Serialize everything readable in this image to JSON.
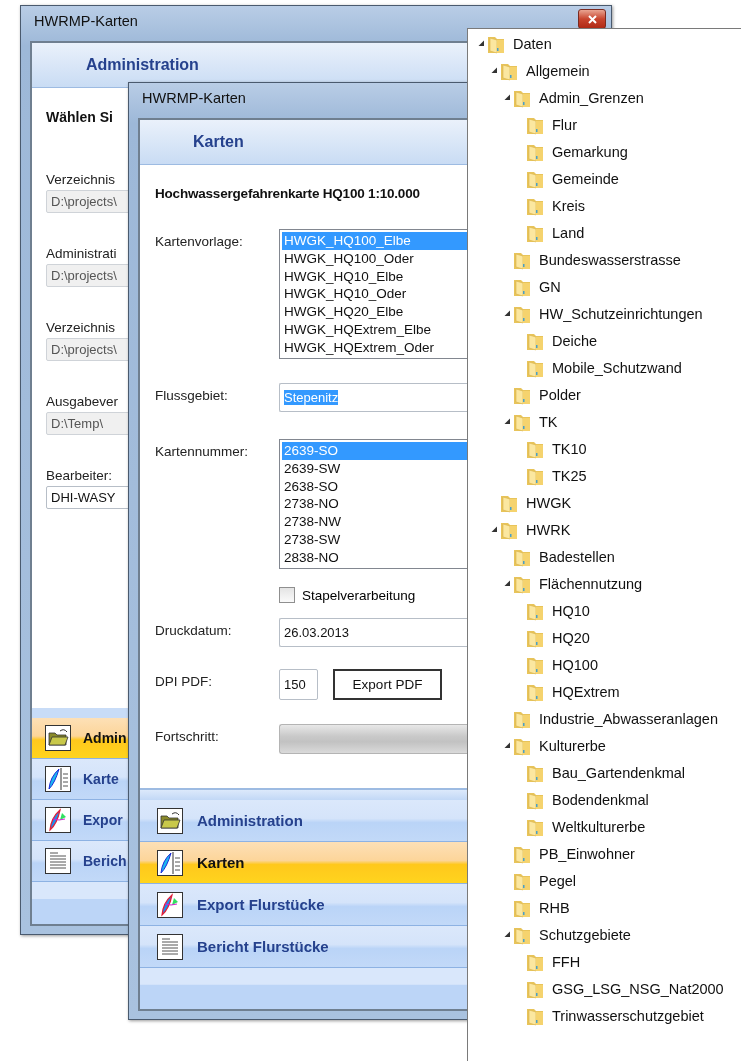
{
  "back_window": {
    "title": "HWRMP-Karten",
    "header": "Administration",
    "heading": "Wählen Si",
    "fields": [
      {
        "label": "Verzeichnis",
        "value": "D:\\projects\\",
        "disabled": true
      },
      {
        "label": "Administrati",
        "value": "D:\\projects\\",
        "disabled": true
      },
      {
        "label": "Verzeichnis",
        "value": "D:\\projects\\",
        "disabled": true
      },
      {
        "label": "Ausgabever",
        "value": "D:\\Temp\\",
        "disabled": true
      },
      {
        "label": "Bearbeiter:",
        "value": "DHI-WASY",
        "disabled": false
      }
    ],
    "nav": [
      {
        "label": "Admin",
        "kind": "folder",
        "selected": true
      },
      {
        "label": "Karte",
        "kind": "quill",
        "selected": false
      },
      {
        "label": "Expor",
        "kind": "export",
        "selected": false
      },
      {
        "label": "Berich",
        "kind": "report",
        "selected": false
      }
    ]
  },
  "front_window": {
    "title": "HWRMP-Karten",
    "header": "Karten",
    "heading": "Hochwassergefahrenkarte HQ100 1:10.000",
    "template_list": {
      "label": "Kartenvorlage:",
      "items": [
        {
          "text": "HWGK_HQ100_Elbe",
          "selected": true
        },
        {
          "text": "HWGK_HQ100_Oder",
          "selected": false
        },
        {
          "text": "HWGK_HQ10_Elbe",
          "selected": false
        },
        {
          "text": "HWGK_HQ10_Oder",
          "selected": false
        },
        {
          "text": "HWGK_HQ20_Elbe",
          "selected": false
        },
        {
          "text": "HWGK_HQExtrem_Elbe",
          "selected": false
        },
        {
          "text": "HWGK_HQExtrem_Oder",
          "selected": false
        }
      ]
    },
    "river": {
      "label": "Flussgebiet:",
      "value": "Stepenitz",
      "text_selected": true
    },
    "map_numbers": {
      "label": "Kartennummer:",
      "items": [
        {
          "text": "2639-SO",
          "selected": true
        },
        {
          "text": "2639-SW",
          "selected": false
        },
        {
          "text": "2638-SO",
          "selected": false
        },
        {
          "text": "2738-NO",
          "selected": false
        },
        {
          "text": "2738-NW",
          "selected": false
        },
        {
          "text": "2738-SW",
          "selected": false
        },
        {
          "text": "2838-NO",
          "selected": false
        }
      ]
    },
    "batch": {
      "label": "Stapelverarbeitung",
      "checked": false
    },
    "print_date": {
      "label": "Druckdatum:",
      "value": "26.03.2013"
    },
    "dpi": {
      "label": "DPI PDF:",
      "value": "150"
    },
    "export_button": "Export PDF",
    "progress": {
      "label": "Fortschritt:",
      "level": 0
    },
    "nav": [
      {
        "label": "Administration",
        "kind": "folder",
        "selected": false
      },
      {
        "label": "Karten",
        "kind": "quill",
        "selected": true
      },
      {
        "label": "Export Flurstücke",
        "kind": "export",
        "selected": false
      },
      {
        "label": "Bericht Flurstücke",
        "kind": "report",
        "selected": false
      }
    ]
  },
  "tree": [
    {
      "label": "Daten",
      "expanded": true,
      "children": [
        {
          "label": "Allgemein",
          "expanded": true,
          "children": [
            {
              "label": "Admin_Grenzen",
              "expanded": true,
              "children": [
                {
                  "label": "Flur"
                },
                {
                  "label": "Gemarkung"
                },
                {
                  "label": "Gemeinde"
                },
                {
                  "label": "Kreis"
                },
                {
                  "label": "Land"
                }
              ]
            },
            {
              "label": "Bundeswasserstrasse"
            },
            {
              "label": "GN"
            },
            {
              "label": "HW_Schutzeinrichtungen",
              "expanded": true,
              "children": [
                {
                  "label": "Deiche"
                },
                {
                  "label": "Mobile_Schutzwand"
                }
              ]
            },
            {
              "label": "Polder"
            },
            {
              "label": "TK",
              "expanded": true,
              "children": [
                {
                  "label": "TK10"
                },
                {
                  "label": "TK25"
                }
              ]
            }
          ]
        },
        {
          "label": "HWGK"
        },
        {
          "label": "HWRK",
          "expanded": true,
          "children": [
            {
              "label": "Badestellen"
            },
            {
              "label": "Flächennutzung",
              "expanded": true,
              "children": [
                {
                  "label": "HQ10"
                },
                {
                  "label": "HQ20"
                },
                {
                  "label": "HQ100"
                },
                {
                  "label": "HQExtrem"
                }
              ]
            },
            {
              "label": "Industrie_Abwasseranlagen"
            },
            {
              "label": "Kulturerbe",
              "expanded": true,
              "children": [
                {
                  "label": "Bau_Gartendenkmal"
                },
                {
                  "label": "Bodendenkmal"
                },
                {
                  "label": "Weltkulturerbe"
                }
              ]
            },
            {
              "label": "PB_Einwohner"
            },
            {
              "label": "Pegel"
            },
            {
              "label": "RHB"
            },
            {
              "label": "Schutzgebiete",
              "expanded": true,
              "children": [
                {
                  "label": "FFH"
                },
                {
                  "label": "GSG_LSG_NSG_Nat2000"
                },
                {
                  "label": "Trinwasserschutzgebiet"
                }
              ]
            }
          ]
        }
      ]
    }
  ]
}
